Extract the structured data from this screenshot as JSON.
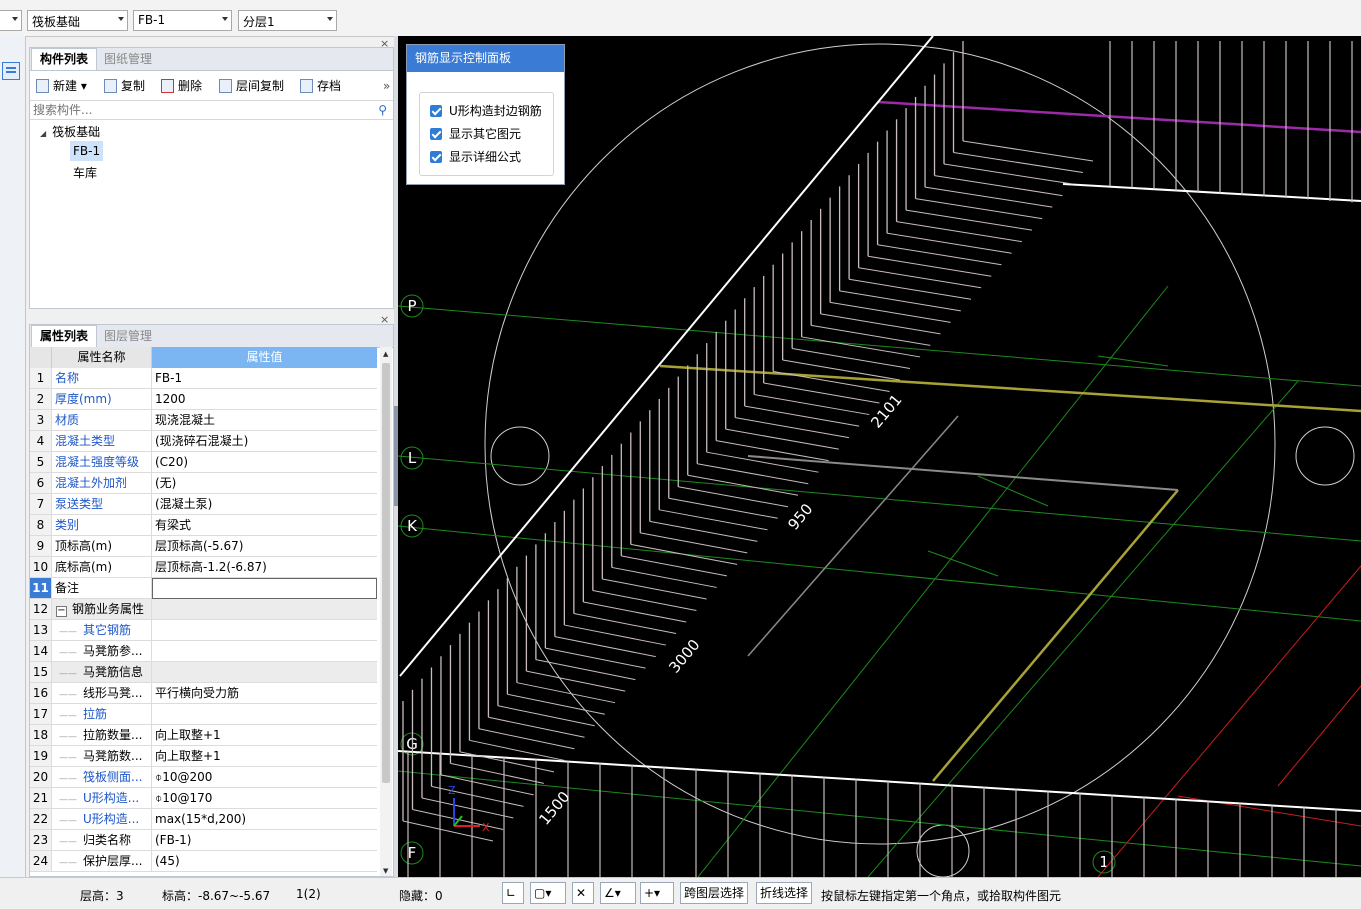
{
  "topbar": {
    "combo1": "",
    "combo2": "筏板基础",
    "combo3": "FB-1",
    "combo4": "分层1"
  },
  "component_panel": {
    "tabs": [
      "构件列表",
      "图纸管理"
    ],
    "toolbar": {
      "new": "新建",
      "copy": "复制",
      "delete": "删除",
      "floor_copy": "层间复制",
      "archive": "存档"
    },
    "search_placeholder": "搜索构件...",
    "tree": {
      "root": "筏板基础",
      "children": [
        "FB-1",
        "车库"
      ]
    }
  },
  "property_panel": {
    "tabs": [
      "属性列表",
      "图层管理"
    ],
    "headers": [
      "属性名称",
      "属性值"
    ],
    "rows": [
      {
        "n": "1",
        "name": "名称",
        "value": "FB-1"
      },
      {
        "n": "2",
        "name": "厚度(mm)",
        "value": "1200"
      },
      {
        "n": "3",
        "name": "材质",
        "value": "现浇混凝土"
      },
      {
        "n": "4",
        "name": "混凝土类型",
        "value": "(现浇碎石混凝土)"
      },
      {
        "n": "5",
        "name": "混凝土强度等级",
        "value": "(C20)"
      },
      {
        "n": "6",
        "name": "混凝土外加剂",
        "value": "(无)"
      },
      {
        "n": "7",
        "name": "泵送类型",
        "value": "(混凝土泵)"
      },
      {
        "n": "8",
        "name": "类别",
        "value": "有梁式"
      },
      {
        "n": "9",
        "name": "顶标高(m)",
        "value": "层顶标高(-5.67)"
      },
      {
        "n": "10",
        "name": "底标高(m)",
        "value": "层顶标高-1.2(-6.87)"
      },
      {
        "n": "11",
        "name": "备注",
        "value": ""
      },
      {
        "n": "12",
        "name": "钢筋业务属性",
        "value": ""
      },
      {
        "n": "13",
        "name": "其它钢筋",
        "value": ""
      },
      {
        "n": "14",
        "name": "马凳筋参...",
        "value": ""
      },
      {
        "n": "15",
        "name": "马凳筋信息",
        "value": ""
      },
      {
        "n": "16",
        "name": "线形马凳...",
        "value": "平行横向受力筋"
      },
      {
        "n": "17",
        "name": "拉筋",
        "value": ""
      },
      {
        "n": "18",
        "name": "拉筋数量...",
        "value": "向上取整+1"
      },
      {
        "n": "19",
        "name": "马凳筋数...",
        "value": "向上取整+1"
      },
      {
        "n": "20",
        "name": "筏板侧面...",
        "value": "⌽10@200"
      },
      {
        "n": "21",
        "name": "U形构造...",
        "value": "⌽10@170"
      },
      {
        "n": "22",
        "name": "U形构造...",
        "value": "max(15*d,200)"
      },
      {
        "n": "23",
        "name": "归类名称",
        "value": "(FB-1)"
      },
      {
        "n": "24",
        "name": "保护层厚...",
        "value": "(45)"
      }
    ]
  },
  "control_panel": {
    "title": "钢筋显示控制面板",
    "options": [
      "U形构造封边钢筋",
      "显示其它图元",
      "显示详细公式"
    ]
  },
  "viewport": {
    "axis_labels": [
      "P",
      "L",
      "K",
      "G",
      "F",
      "1"
    ],
    "dimensions": [
      "2101",
      "950",
      "3000",
      "1500"
    ],
    "triad": {
      "x": "X",
      "z": "Z"
    }
  },
  "status": {
    "floor_height": "层高：3",
    "elevation": "标高：-8.67~-5.67",
    "count": "1(2)",
    "hidden": "隐藏：0",
    "cross_floor_select": "跨图层选择",
    "polyline_select": "折线选择",
    "hint": "按鼠标左键指定第一个角点，或拾取构件图元"
  },
  "colors": {
    "accent": "#3a7bd5",
    "header_blue": "#7cb6f2",
    "link_blue": "#1f57c8"
  }
}
